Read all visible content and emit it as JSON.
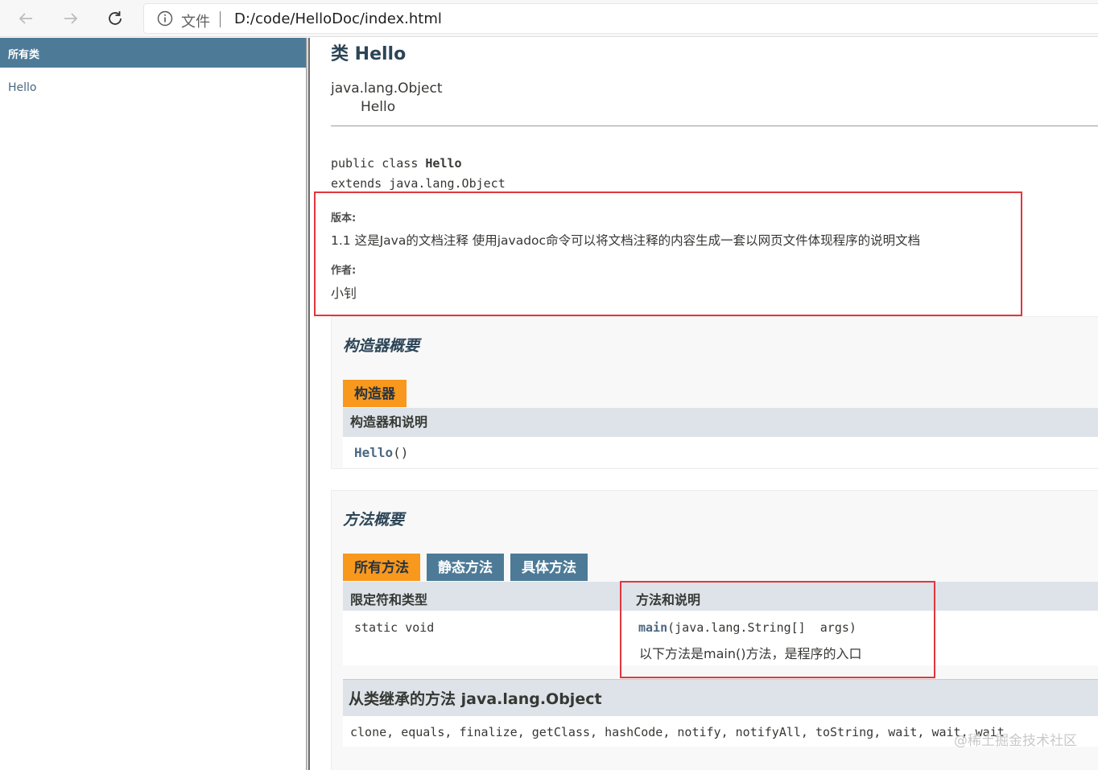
{
  "browser": {
    "address_label": "文件",
    "url": "D:/code/HelloDoc/index.html"
  },
  "left_frame": {
    "header": "所有类",
    "classes": [
      "Hello"
    ]
  },
  "class_page": {
    "title": "类 Hello",
    "inheritance": [
      "java.lang.Object",
      "Hello"
    ],
    "declaration": {
      "line1_prefix": "public class ",
      "line1_name": "Hello",
      "line2": "extends java.lang.Object"
    },
    "tags": {
      "version_label": "版本:",
      "version_value": "1.1 这是Java的文档注释 使用javadoc命令可以将文档注释的内容生成一套以网页文件体现程序的说明文档",
      "author_label": "作者:",
      "author_value": "小钊"
    },
    "constructor_summary": {
      "title": "构造器概要",
      "tab": "构造器",
      "column_header": "构造器和说明",
      "rows": [
        {
          "name": "Hello",
          "suffix": "()"
        }
      ]
    },
    "method_summary": {
      "title": "方法概要",
      "tabs": [
        "所有方法",
        "静态方法",
        "具体方法"
      ],
      "column_headers": [
        "限定符和类型",
        "方法和说明"
      ],
      "rows": [
        {
          "modifier": "static void",
          "method_name": "main",
          "method_params": "(java.lang.String[]  args)",
          "description": "以下方法是main()方法，是程序的入口"
        }
      ]
    },
    "inherited": {
      "title": "从类继承的方法 java.lang.Object",
      "methods": "clone, equals, finalize, getClass, hashCode, notify, notifyAll, toString, wait, wait, wait"
    }
  },
  "watermark": "@稀土掘金技术社区",
  "colors": {
    "header_blue": "#4d7a97",
    "tab_orange": "#f8981d",
    "highlight_red": "#e0373d"
  }
}
